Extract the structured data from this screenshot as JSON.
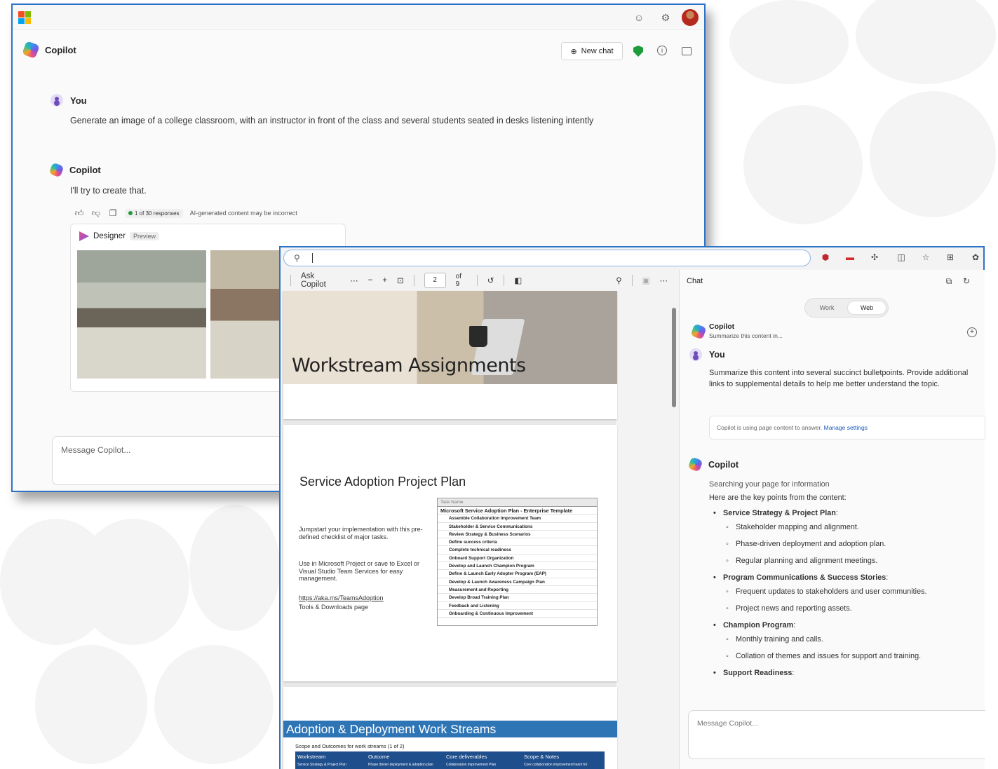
{
  "win1": {
    "app_title": "Copilot",
    "new_chat": "New chat",
    "user_label": "You",
    "user_prompt": "Generate an image of a college classroom, with an instructor in front of the class and several students seated in desks listening intently",
    "bot_label": "Copilot",
    "bot_reply": "I'll try to create that.",
    "responses": "1 of 30 responses",
    "disclaimer": "AI-generated content may be incorrect",
    "designer": "Designer",
    "preview": "Preview",
    "message_placeholder": "Message Copilot..."
  },
  "pdf": {
    "ask_copilot": "Ask Copilot",
    "page_value": "2",
    "page_total": "of 9",
    "page1_title": "Workstream Assignments",
    "page2_title": "Service Adoption Project Plan",
    "page2_text1": "Jumpstart your implementation with this pre-defined checklist of major tasks.",
    "page2_text2": "Use in Microsoft Project or save to Excel or Visual Studio Team Services for easy management.",
    "page2_link": "https://aka.ms/TeamsAdoption",
    "page2_text3": "Tools & Downloads page",
    "task_header": "Task Name",
    "tasks": [
      "Microsoft Service Adoption Plan - Enterprise Template",
      "Assemble Collaboration Improvement Team",
      "Stakeholder & Service Communications",
      "Review Strategy & Business Scenarios",
      "Define success criteria",
      "Complete technical readiness",
      "Onboard Support Organization",
      "Develop and Launch Champion Program",
      "Define & Launch Early Adopter Program (EAP)",
      "Develop & Launch Awareness Campaign Plan",
      "Measurement and Reporting",
      "Develop    Broad Training Plan",
      "Feedback and Listening",
      "Onboarding & Continuous Improvement"
    ],
    "page3_title": "Adoption & Deployment Work Streams",
    "page3_sub": "Scope and Outcomes for work streams (1 of 2)",
    "table_headers": [
      "Workstream",
      "Outcome",
      "Core deliverables",
      "Scope & Notes"
    ],
    "table_row": [
      "Service Strategy & Project Plan",
      "Phase driven deployment & adoption plan",
      "Collaboration improvement Plan",
      "Core collaboration improvement team for"
    ]
  },
  "chat": {
    "title": "Chat",
    "tab_work": "Work",
    "tab_web": "Web",
    "summary_title": "Copilot",
    "summary_sub": "Summarize this content in...",
    "user_label": "You",
    "user_text": "Summarize this content into several succinct bulletpoints.  Provide additional links to supplemental details to help me better understand the topic.",
    "notice": "Copilot is using page content to answer.",
    "manage": "Manage settings",
    "bot_label": "Copilot",
    "searching": "Searching your page for information",
    "intro": "Here are the key points from the content:",
    "b1": "Service Strategy & Project Plan",
    "b1a": "Stakeholder mapping and alignment.",
    "b1b": "Phase-driven deployment and adoption plan.",
    "b1c": "Regular planning and alignment meetings.",
    "b2": "Program Communications & Success Stories",
    "b2a": "Frequent updates to stakeholders and user communities.",
    "b2b": "Project news and reporting assets.",
    "b3": "Champion Program",
    "b3a": "Monthly training and calls.",
    "b3b": "Collation of themes and issues for support and training.",
    "b4": "Support Readiness",
    "colon": ":",
    "message_placeholder": "Message Copilot..."
  },
  "colors": {
    "accent": "#2c73c7",
    "band": "#2e75b6"
  }
}
